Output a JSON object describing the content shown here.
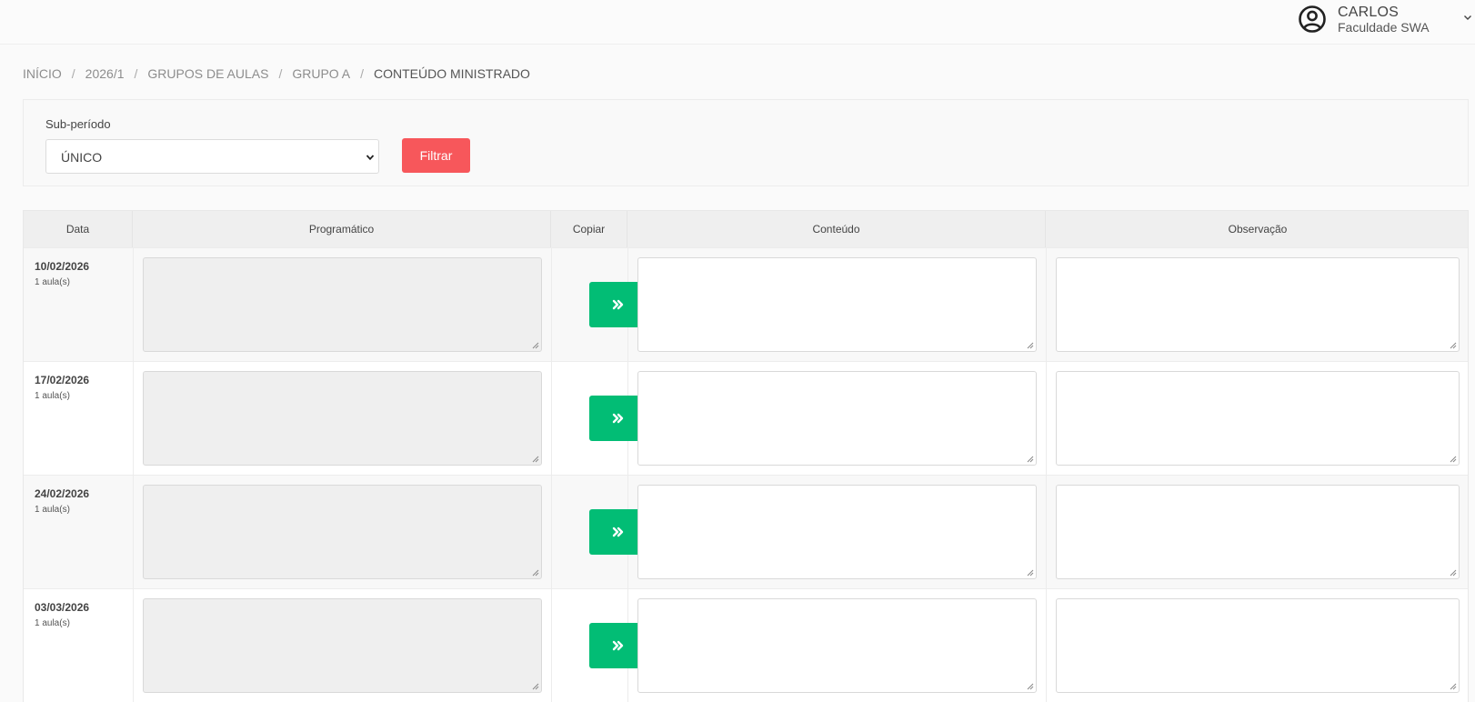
{
  "user": {
    "name": "CARLOS",
    "organization": "Faculdade SWA",
    "avatar_icon": "user-circle-icon",
    "menu_icon": "chevron-down-icon"
  },
  "breadcrumb": {
    "items": [
      "INÍCIO",
      "2026/1",
      "GRUPOS DE AULAS",
      "GRUPO A"
    ],
    "current": "CONTEÚDO MINISTRADO",
    "separator": "/"
  },
  "filter": {
    "label": "Sub-período",
    "selected": "ÚNICO",
    "button_label": "Filtrar",
    "button_color": "#f7575b"
  },
  "table": {
    "headers": {
      "date": "Data",
      "program": "Programático",
      "copy": "Copiar",
      "content": "Conteúdo",
      "observation": "Observação"
    },
    "copy_icon": "double-chevron-right-icon",
    "copy_button_color": "#02bd75",
    "rows": [
      {
        "date": "10/02/2026",
        "classes": "1 aula(s)",
        "program": "",
        "content": "",
        "observation": ""
      },
      {
        "date": "17/02/2026",
        "classes": "1 aula(s)",
        "program": "",
        "content": "",
        "observation": ""
      },
      {
        "date": "24/02/2026",
        "classes": "1 aula(s)",
        "program": "",
        "content": "",
        "observation": ""
      },
      {
        "date": "03/03/2026",
        "classes": "1 aula(s)",
        "program": "",
        "content": "",
        "observation": ""
      }
    ]
  }
}
